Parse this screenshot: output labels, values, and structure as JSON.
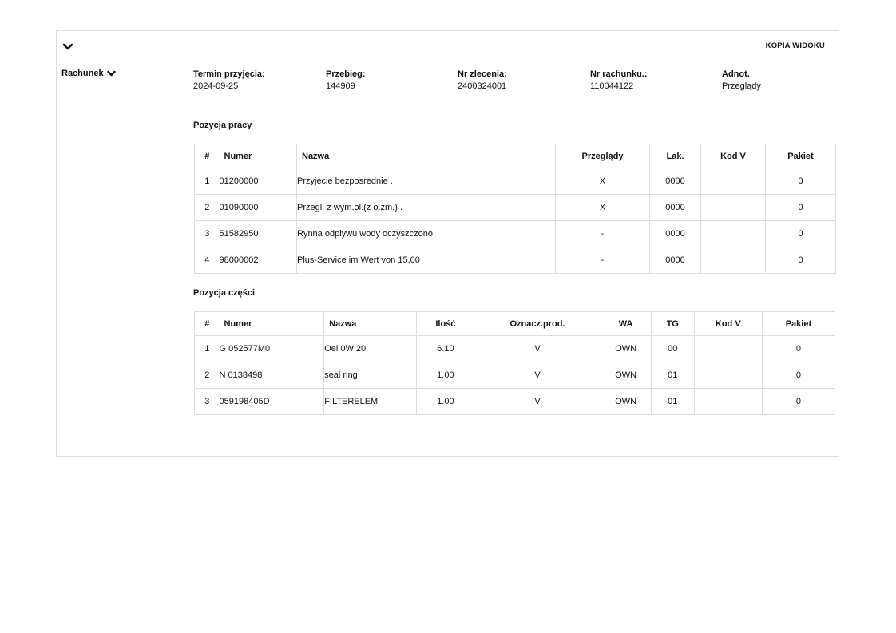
{
  "toolbar": {
    "copy_view_label": "KOPIA WIDOKU"
  },
  "invoice": {
    "toggle_label": "Rachunek",
    "fields": [
      {
        "label": "Termin przyjęcia:",
        "value": "2024-09-25"
      },
      {
        "label": "Przebieg:",
        "value": "144909"
      },
      {
        "label": "Nr zlecenia:",
        "value": "2400324001"
      },
      {
        "label": "Nr rachunku.:",
        "value": "110044122"
      },
      {
        "label": "Adnot.",
        "value": "Przeglądy"
      }
    ]
  },
  "labor": {
    "title": "Pozycja pracy",
    "columns": [
      "#",
      "Numer",
      "Nazwa",
      "Przeglądy",
      "Lak.",
      "Kod V",
      "Pakiet"
    ],
    "rows": [
      [
        "1",
        "01200000",
        "Przyjecie bezposrednie .",
        "X",
        "0000",
        "",
        "0"
      ],
      [
        "2",
        "01090000",
        "Przegl. z wym.ol.(z o.zm.) .",
        "X",
        "0000",
        "",
        "0"
      ],
      [
        "3",
        "51582950",
        "Rynna odplywu wody oczyszczono",
        "-",
        "0000",
        "",
        "0"
      ],
      [
        "4",
        "98000002",
        "Plus-Service im Wert von 15,00",
        "-",
        "0000",
        "",
        "0"
      ]
    ]
  },
  "parts": {
    "title": "Pozycja części",
    "columns": [
      "#",
      "Numer",
      "Nazwa",
      "Ilość",
      "Oznacz.prod.",
      "WA",
      "TG",
      "Kod V",
      "Pakiet"
    ],
    "rows": [
      [
        "1",
        "G 052577M0",
        "Oel 0W 20",
        "6.10",
        "V",
        "OWN",
        "00",
        "",
        "0"
      ],
      [
        "2",
        "N 0138498",
        "seal ring",
        "1.00",
        "V",
        "OWN",
        "01",
        "",
        "0"
      ],
      [
        "3",
        "059198405D",
        "FILTERELEM",
        "1.00",
        "V",
        "OWN",
        "01",
        "",
        "0"
      ]
    ]
  }
}
